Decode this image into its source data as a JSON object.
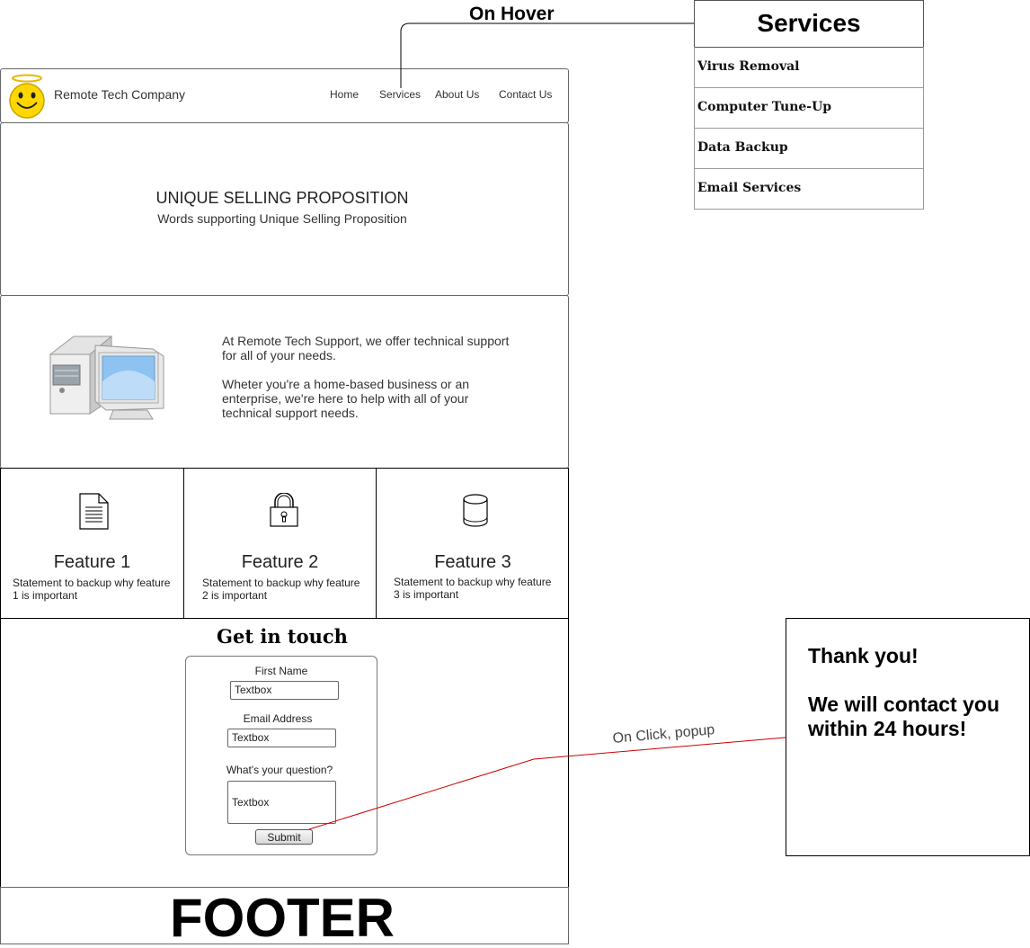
{
  "header": {
    "company": "Remote Tech Company",
    "nav": [
      "Home",
      "Services",
      "About Us",
      "Contact Us"
    ]
  },
  "hero": {
    "title": "UNIQUE SELLING PROPOSITION",
    "subtitle": "Words supporting Unique Selling Proposition"
  },
  "about": {
    "para1_line1": "At Remote Tech Support, we offer technical support",
    "para1_line2": "for all of your needs.",
    "para2_line1": "Wheter you're a home-based business or an",
    "para2_line2": "enterprise, we're here to help with all of your",
    "para2_line3": "technical support needs."
  },
  "features": [
    {
      "title": "Feature 1",
      "line1": "Statement to backup why feature",
      "line2": "1 is important",
      "icon": "document-icon"
    },
    {
      "title": "Feature 2",
      "line1": "Statement to backup why feature",
      "line2": "2 is important",
      "icon": "lock-icon"
    },
    {
      "title": "Feature 3",
      "line1": "Statement to backup why feature",
      "line2": "3 is important",
      "icon": "database-icon"
    }
  ],
  "contact": {
    "title": "Get in touch",
    "first_name_label": "First Name",
    "first_name_value": "Textbox",
    "email_label": "Email Address",
    "email_value": "Textbox",
    "question_label": "What's your question?",
    "question_value": "Textbox",
    "submit": "Submit"
  },
  "footer": {
    "text": "FOOTER"
  },
  "annotations": {
    "on_hover": "On Hover",
    "on_click": "On Click, popup"
  },
  "services_menu": {
    "title": "Services",
    "items": [
      "Virus Removal",
      "Computer Tune-Up",
      "Data Backup",
      "Email Services"
    ]
  },
  "popup": {
    "line1": "Thank you!",
    "line2": "We will contact you within 24 hours!"
  },
  "colors": {
    "connector_line": "#000000",
    "click_connector": "#cc0000",
    "screen_blue": "#8ec2f0"
  }
}
